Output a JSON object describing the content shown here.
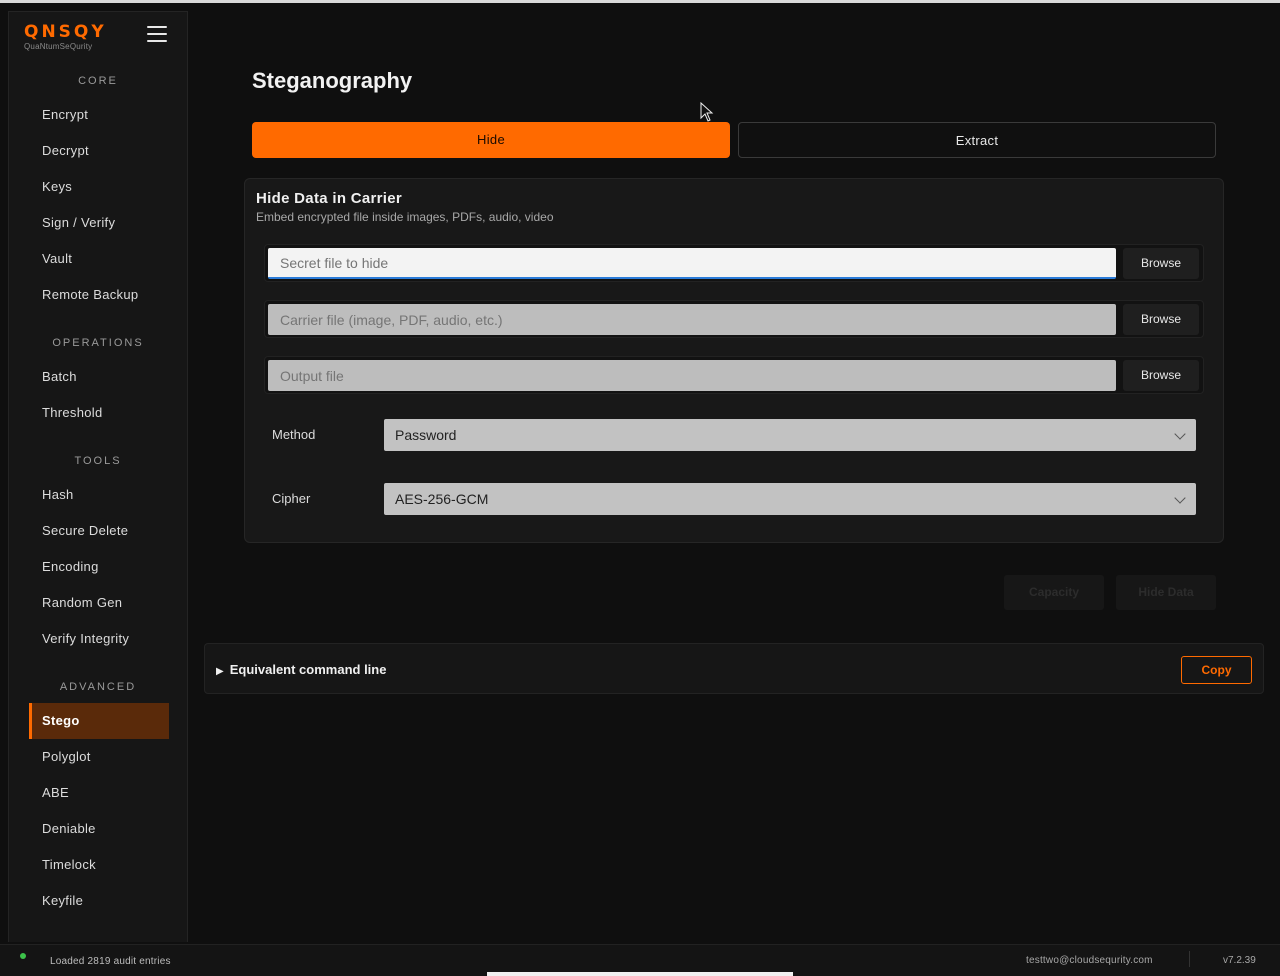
{
  "brand": {
    "logo": "QNSQY",
    "tagline": "QuaNtumSeQurity"
  },
  "sidebar": {
    "sections": [
      {
        "label": "CORE",
        "items": [
          "Encrypt",
          "Decrypt",
          "Keys",
          "Sign / Verify",
          "Vault",
          "Remote Backup"
        ]
      },
      {
        "label": "OPERATIONS",
        "items": [
          "Batch",
          "Threshold"
        ]
      },
      {
        "label": "TOOLS",
        "items": [
          "Hash",
          "Secure Delete",
          "Encoding",
          "Random Gen",
          "Verify Integrity"
        ]
      },
      {
        "label": "ADVANCED",
        "items": [
          "Stego",
          "Polyglot",
          "ABE",
          "Deniable",
          "Timelock",
          "Keyfile"
        ]
      }
    ],
    "active_item": "Stego"
  },
  "page": {
    "title": "Steganography"
  },
  "tabs": {
    "hide": "Hide",
    "extract": "Extract",
    "active": "Hide"
  },
  "panel": {
    "title": "Hide Data in Carrier",
    "subtitle": "Embed encrypted file inside images, PDFs, audio, video",
    "secret_file": {
      "placeholder": "Secret file to hide",
      "value": "",
      "browse": "Browse"
    },
    "carrier_file": {
      "placeholder": "Carrier file (image, PDF, audio, etc.)",
      "value": "",
      "browse": "Browse"
    },
    "output_file": {
      "placeholder": "Output file",
      "value": "",
      "browse": "Browse"
    },
    "method": {
      "label": "Method",
      "value": "Password"
    },
    "cipher": {
      "label": "Cipher",
      "value": "AES-256-GCM"
    }
  },
  "actions": {
    "capacity": "Capacity",
    "hide_data": "Hide Data"
  },
  "command_line": {
    "toggle_label": "Equivalent command line",
    "copy": "Copy"
  },
  "status_bar": {
    "message": "Loaded 2819 audit entries",
    "user": "testtwo@cloudsequrity.com",
    "version": "v7.2.39"
  },
  "colors": {
    "accent": "#ff6a00",
    "active_bg": "#5a2a0a",
    "status_ok": "#3cc24a"
  }
}
